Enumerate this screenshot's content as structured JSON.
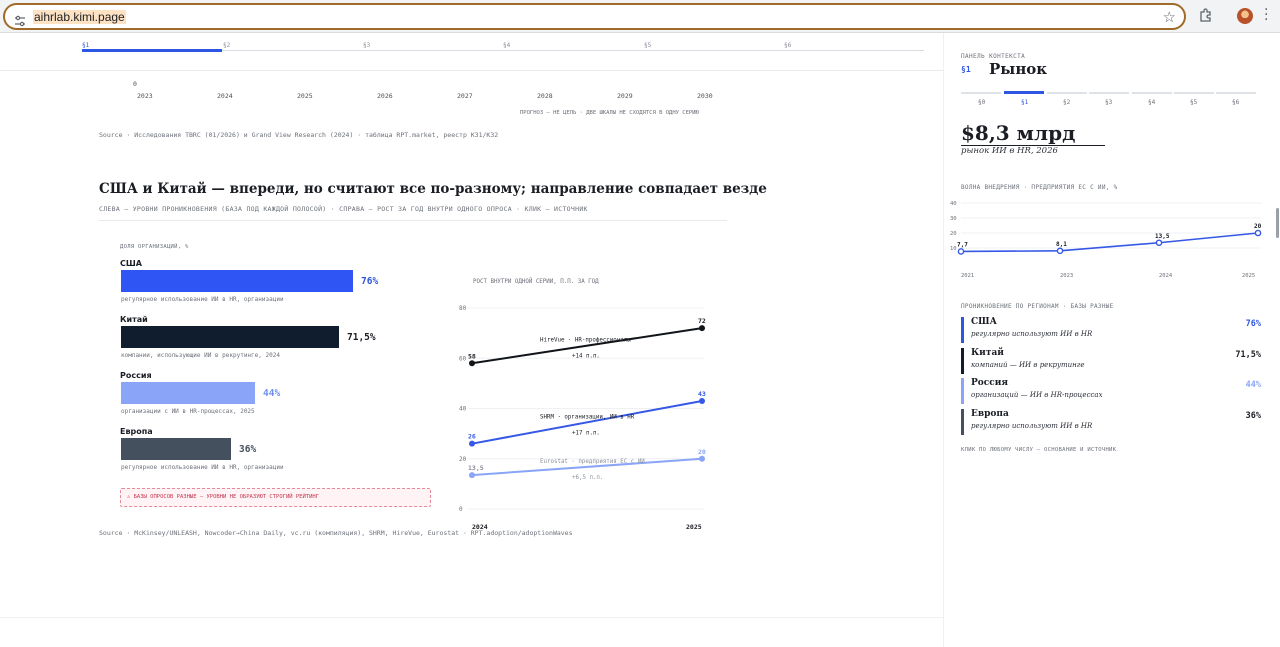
{
  "browser": {
    "url": "aihrlab.kimi.page"
  },
  "sections": [
    "§1",
    "§2",
    "§3",
    "§4",
    "§5",
    "§6"
  ],
  "top_chart": {
    "y_zero": "0",
    "years": [
      "2023",
      "2024",
      "2025",
      "2026",
      "2027",
      "2028",
      "2029",
      "2030"
    ],
    "note": "ПРОГНОЗ — НЕ ЦЕЛЬ · ДВЕ ШКАЛЫ НЕ СХОДЯТСЯ В ОДНУ СЕРИЮ",
    "source": "Source · Исследования TBRC (01/2026) и Grand View Research (2024) · таблица RPT.market, реестр K31/K32"
  },
  "section2": {
    "title": "США и Китай — впереди, но считают все по-разному; направление совпадает везде",
    "subtitle": "СЛЕВА — УРОВНИ ПРОНИКНОВЕНИЯ (БАЗА ПОД КАЖДОЙ ПОЛОСОЙ) · СПРАВА — РОСТ ЗА ГОД ВНУТРИ ОДНОГО ОПРОСА · КЛИК — ИСТОЧНИК",
    "bars_caption": "ДОЛЯ ОРГАНИЗАЦИЙ, %",
    "bars": [
      {
        "country": "США",
        "value": 76,
        "label": "76%",
        "note": "регулярное использование ИИ в HR, организации",
        "color": "#2f56f5",
        "text_color": "#2f56e0"
      },
      {
        "country": "Китай",
        "value": 71.5,
        "label": "71,5%",
        "note": "компании, использующие ИИ в рекрутинге, 2024",
        "color": "#0f1d2e",
        "text_color": "#1a1d24"
      },
      {
        "country": "Россия",
        "value": 44,
        "label": "44%",
        "note": "организации с ИИ в HR-процессах, 2025",
        "color": "#8aa5f7",
        "text_color": "#6f8ff0"
      },
      {
        "country": "Европа",
        "value": 36,
        "label": "36%",
        "note": "регулярное использование ИИ в HR, организации",
        "color": "#44505e",
        "text_color": "#44505e"
      }
    ],
    "warning": "⚠ БАЗЫ ОПРОСОВ РАЗНЫЕ — УРОВНИ НЕ ОБРАЗУЮТ СТРОГИЙ РЕЙТИНГ",
    "source": "Source · McKinsey/UNLEASH, Nowcoder→China Daily, vc.ru (компиляция), SHRM, HireVue, Eurostat · RPT.adoption/adoptionWaves"
  },
  "chart_data": [
    {
      "type": "bar",
      "title": "ДОЛЯ ОРГАНИЗАЦИЙ, %",
      "categories": [
        "США",
        "Китай",
        "Россия",
        "Европа"
      ],
      "values": [
        76,
        71.5,
        44,
        36
      ]
    },
    {
      "type": "line",
      "title": "РОСТ ВНУТРИ ОДНОЙ СЕРИИ, П.П. ЗА ГОД",
      "x": [
        "2024",
        "2025"
      ],
      "ylim": [
        0,
        80
      ],
      "yticks": [
        "0",
        "20",
        "40",
        "60",
        "80"
      ],
      "series": [
        {
          "name": "HireVue · HR-профессионалы",
          "values": [
            58,
            72
          ],
          "labels": [
            "58",
            "72"
          ],
          "delta": "+14 п.п.",
          "color": "#111418"
        },
        {
          "name": "SHRM · организации, ИИ в HR",
          "values": [
            26,
            43
          ],
          "labels": [
            "26",
            "43"
          ],
          "delta": "+17 п.п.",
          "color": "#3558e6"
        },
        {
          "name": "Eurostat · предприятия ЕС с ИИ",
          "values": [
            13.5,
            20
          ],
          "labels": [
            "13,5",
            "20"
          ],
          "delta": "+6,5 п.п.",
          "color": "#8aa5f7"
        }
      ]
    },
    {
      "type": "line",
      "title": "ВОЛНА ВНЕДРЕНИЯ · ПРЕДПРИЯТИЯ ЕС С ИИ, %",
      "x": [
        "2021",
        "2023",
        "2024",
        "2025"
      ],
      "ylim": [
        0,
        40
      ],
      "yticks": [
        "10",
        "20",
        "30",
        "40"
      ],
      "series": [
        {
          "values": [
            7.7,
            8.1,
            13.5,
            20
          ],
          "labels": [
            "7,7",
            "8,1",
            "13,5",
            "20"
          ],
          "color": "#3558e6"
        }
      ]
    }
  ],
  "panel": {
    "context_label": "ПАНЕЛЬ КОНТЕКСТА",
    "section": "§1",
    "title": "Рынок",
    "tabs": [
      "§0",
      "§1",
      "§2",
      "§3",
      "§4",
      "§5",
      "§6"
    ],
    "active_tab": 1,
    "big_value": "$8,3 млрд",
    "big_sub": "рынок ИИ в HR, 2026",
    "wave_label": "ВОЛНА ВНЕДРЕНИЯ · ПРЕДПРИЯТИЯ ЕС С ИИ, %",
    "penetration_label": "ПРОНИКНОВЕНИЕ ПО РЕГИОНАМ · БАЗЫ РАЗНЫЕ",
    "regions": [
      {
        "name": "США",
        "desc": "регулярно используют ИИ в HR",
        "value": "76%",
        "color": "#2f56e0"
      },
      {
        "name": "Китай",
        "desc": "компаний — ИИ в рекрутинге",
        "value": "71,5%",
        "color": "#0f1d2e"
      },
      {
        "name": "Россия",
        "desc": "организаций — ИИ в HR-процессах",
        "value": "44%",
        "color": "#8aa5f7"
      },
      {
        "name": "Европа",
        "desc": "регулярно используют ИИ в HR",
        "value": "36%",
        "color": "#44505e"
      }
    ],
    "click_hint": "КЛИК ПО ЛЮБОМУ ЧИСЛУ — ОСНОВАНИЕ И ИСТОЧНИК"
  }
}
